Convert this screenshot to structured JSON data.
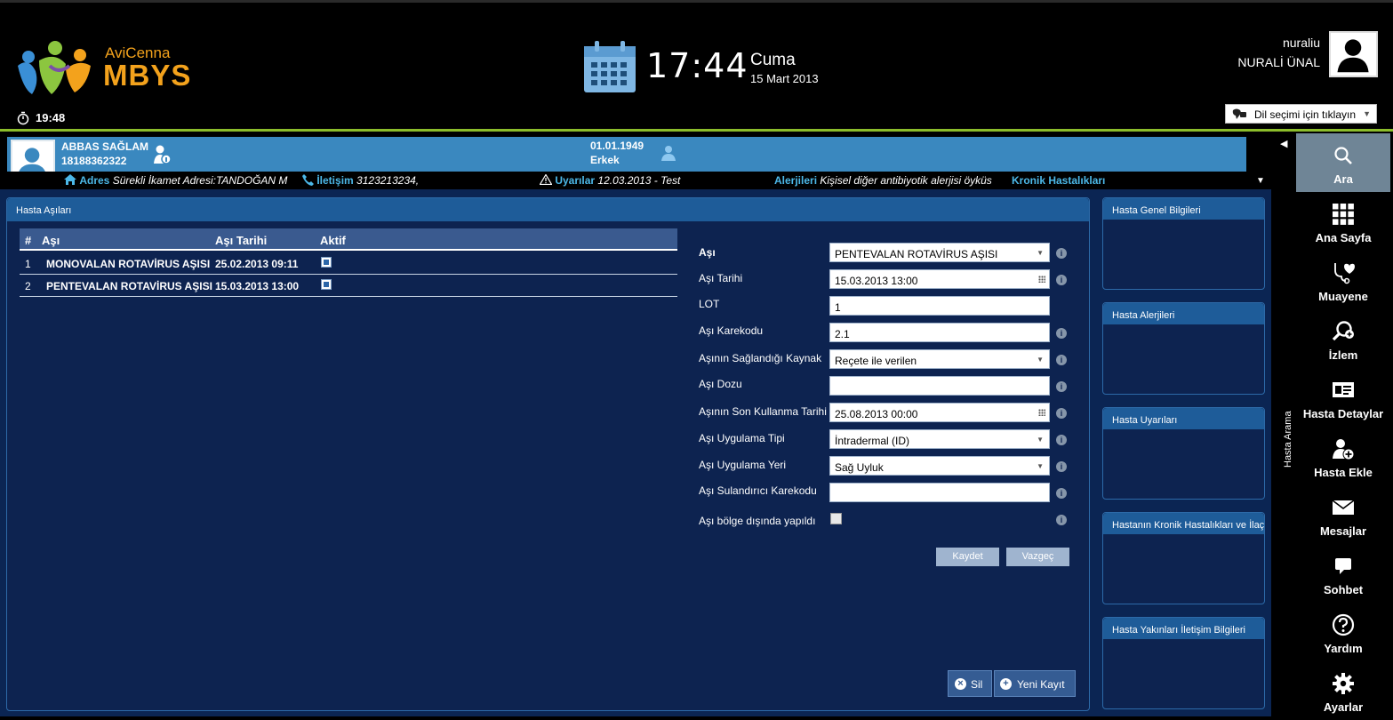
{
  "header": {
    "logo_small": "AviCenna",
    "logo_big": "MBYS",
    "clock_small": "19:48",
    "time": "17:44",
    "day_name": "Cuma",
    "date": "15 Mart 2013",
    "username": "nuraliu",
    "fullname": "NURALİ ÜNAL",
    "language_select": "Dil seçimi için tıklayın"
  },
  "patient": {
    "name": "ABBAS SAĞLAM",
    "id": "18188362322",
    "birth_date": "01.01.1949",
    "gender": "Erkek"
  },
  "info_strip": {
    "address_label": "Adres",
    "address_value": "Sürekli İkamet Adresi:TANDOĞAN M",
    "contact_label": "İletişim",
    "contact_value": "3123213234,",
    "warnings_label": "Uyarılar",
    "warnings_value": "12.03.2013 - Test",
    "allergies_label": "Alerjileri",
    "allergies_value": "Kişisel diğer antibiyotik alerjisi öyküs",
    "chronic_label": "Kronik Hastalıkları"
  },
  "panel": {
    "title": "Hasta Aşıları"
  },
  "table": {
    "headers": [
      "#",
      "Aşı",
      "Aşı Tarihi",
      "Aktif"
    ],
    "rows": [
      {
        "num": "1",
        "vaccine": "MONOVALAN ROTAVİRUS AŞISI",
        "date": "25.02.2013 09:11",
        "active": true
      },
      {
        "num": "2",
        "vaccine": "PENTEVALAN ROTAVİRUS AŞISI",
        "date": "15.03.2013 13:00",
        "active": true
      }
    ]
  },
  "form": {
    "vaccine_label": "Aşı",
    "vaccine_value": "PENTEVALAN ROTAVİRUS AŞISI",
    "date_label": "Aşı Tarihi",
    "date_value": "15.03.2013 13:00",
    "lot_label": "LOT",
    "lot_value": "1",
    "barcode_label": "Aşı Karekodu",
    "barcode_value": "2.1",
    "source_label": "Aşının Sağlandığı Kaynak",
    "source_value": "Reçete ile verilen",
    "dose_label": "Aşı Dozu",
    "dose_value": "",
    "expiry_label": "Aşının Son Kullanma Tarihi",
    "expiry_value": "25.08.2013 00:00",
    "app_type_label": "Aşı Uygulama Tipi",
    "app_type_value": "İntradermal (ID)",
    "app_site_label": "Aşı Uygulama Yeri",
    "app_site_value": "Sağ Uyluk",
    "diluent_label": "Aşı Sulandırıcı Karekodu",
    "diluent_value": "",
    "out_of_region_label": "Aşı bölge dışında yapıldı",
    "out_of_region_checked": false,
    "save_button": "Kaydet",
    "cancel_button": "Vazgeç",
    "delete_button": "Sil",
    "new_record_button": "Yeni Kayıt"
  },
  "cards": [
    {
      "title": "Hasta Genel Bilgileri"
    },
    {
      "title": "Hasta Alerjileri"
    },
    {
      "title": "Hasta Uyarıları"
    },
    {
      "title": "Hastanın Kronik Hastalıkları ve İlaç"
    },
    {
      "title": "Hasta Yakınları İletişim Bilgileri"
    }
  ],
  "side_label": "Hasta Arama",
  "nav": [
    {
      "label": "Ara",
      "icon": "search-icon"
    },
    {
      "label": "Ana Sayfa",
      "icon": "grid-icon"
    },
    {
      "label": "Muayene",
      "icon": "stethoscope-heart-icon"
    },
    {
      "label": "İzlem",
      "icon": "magnifier-plus-icon"
    },
    {
      "label": "Hasta Detaylar",
      "icon": "id-card-icon"
    },
    {
      "label": "Hasta Ekle",
      "icon": "add-user-icon"
    },
    {
      "label": "Mesajlar",
      "icon": "envelope-icon"
    },
    {
      "label": "Sohbet",
      "icon": "chat-bubble-icon"
    },
    {
      "label": "Yardım",
      "icon": "help-icon"
    },
    {
      "label": "Ayarlar",
      "icon": "gear-icon"
    }
  ],
  "colors": {
    "accent_green": "#8cbd2b",
    "patient_bar": "#3a88bf",
    "panel_bg": "#0b2553",
    "panel_header": "#1e5c99",
    "logo_orange": "#f3a21c",
    "strip_label": "#4cb8e8"
  }
}
